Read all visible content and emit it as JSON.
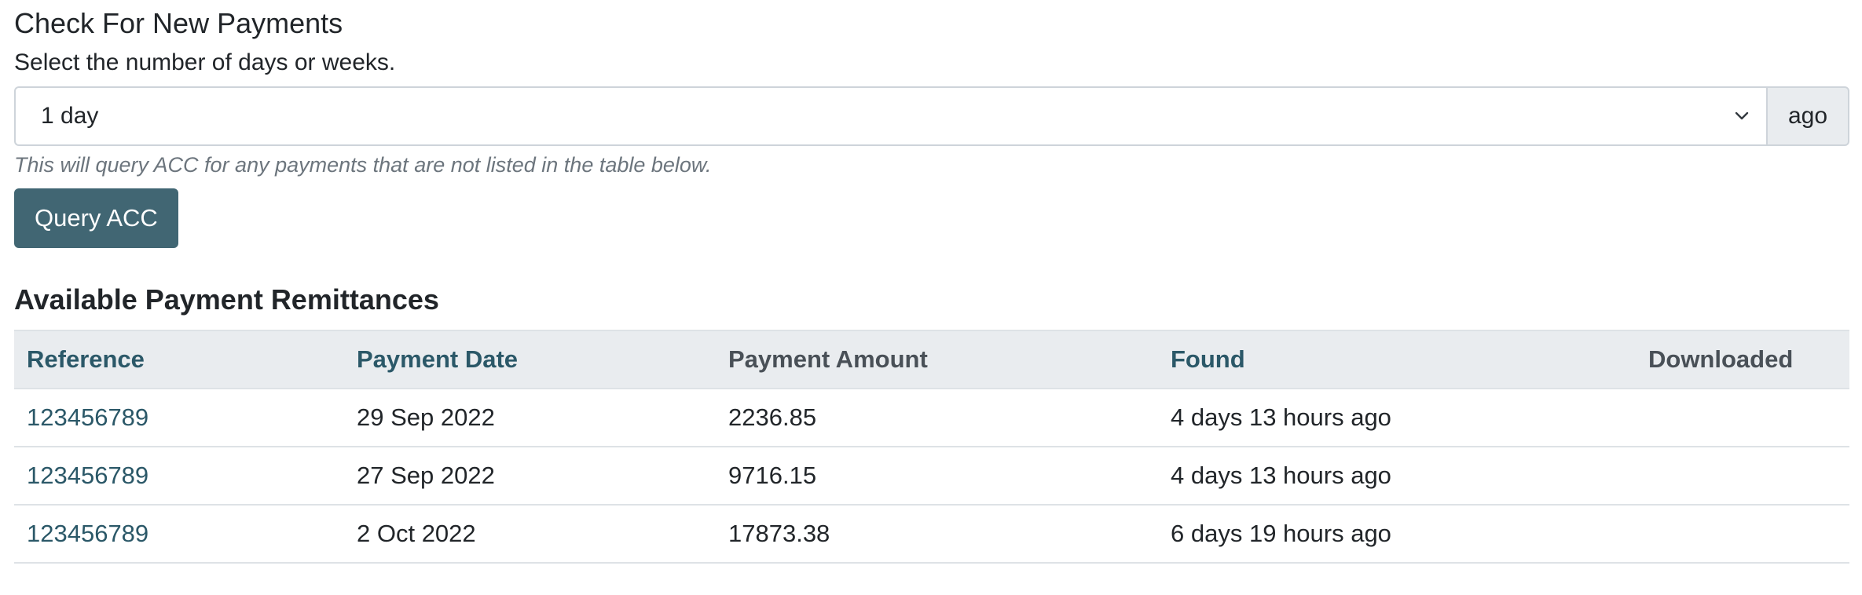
{
  "check": {
    "title": "Check For New Payments",
    "label": "Select the number of days or weeks.",
    "select_value": "1 day",
    "addon": "ago",
    "hint": "This will query ACC for any payments that are not listed in the table below.",
    "button_label": "Query ACC"
  },
  "remittances": {
    "title": "Available Payment Remittances",
    "columns": [
      "Reference",
      "Payment Date",
      "Payment Amount",
      "Found",
      "Downloaded"
    ],
    "rows": [
      {
        "reference": "123456789",
        "payment_date": "29 Sep 2022",
        "payment_amount": "2236.85",
        "found": "4 days 13 hours ago",
        "downloaded": ""
      },
      {
        "reference": "123456789",
        "payment_date": "27 Sep 2022",
        "payment_amount": "9716.15",
        "found": "4 days 13 hours ago",
        "downloaded": ""
      },
      {
        "reference": "123456789",
        "payment_date": "2 Oct 2022",
        "payment_amount": "17873.38",
        "found": "6 days 19 hours ago",
        "downloaded": ""
      }
    ]
  },
  "colors": {
    "primary_button": "#416673",
    "link": "#2b5868",
    "header_bg": "#e9ecef"
  },
  "icons": {
    "select_chevron": "chevron-down-icon"
  }
}
